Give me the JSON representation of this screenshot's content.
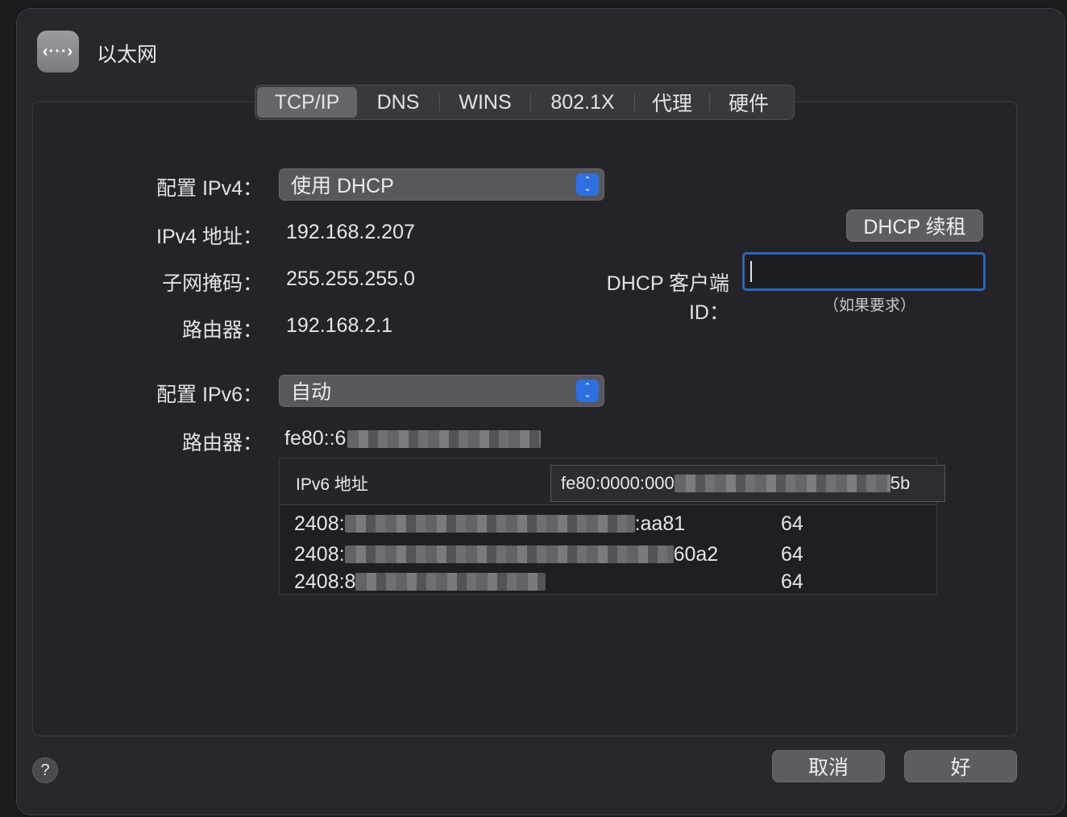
{
  "header": {
    "icon": "ethernet-dots-icon",
    "icon_glyph": "‹···›",
    "title": "以太网"
  },
  "tabs": [
    {
      "label": "TCP/IP",
      "active": true
    },
    {
      "label": "DNS"
    },
    {
      "label": "WINS"
    },
    {
      "label": "802.1X"
    },
    {
      "label": "代理"
    },
    {
      "label": "硬件"
    }
  ],
  "ipv4": {
    "configure_label": "配置 IPv4：",
    "configure_value": "使用 DHCP",
    "address_label": "IPv4 地址：",
    "address_value": "192.168.2.207",
    "subnet_label": "子网掩码：",
    "subnet_value": "255.255.255.0",
    "router_label": "路由器：",
    "router_value": "192.168.2.1"
  },
  "dhcp": {
    "renew_button": "DHCP 续租",
    "client_id_label": "DHCP 客户端 ID：",
    "client_id_value": "",
    "client_id_hint": "（如果要求）"
  },
  "ipv6": {
    "configure_label": "配置 IPv6：",
    "configure_value": "自动",
    "router_label": "路由器：",
    "router_value_visible": "fe80::6",
    "table_header": "IPv6 地址",
    "tooltip_start": "fe80:0000:000",
    "tooltip_end": "5b",
    "rows": [
      {
        "start": "2408:",
        "end": ":aa81",
        "prefix": "64"
      },
      {
        "start": "2408:",
        "end": "60a2",
        "prefix": "64"
      },
      {
        "start": "2408:8",
        "end": "",
        "prefix": "64"
      }
    ]
  },
  "footer": {
    "help": "?",
    "cancel": "取消",
    "ok": "好"
  },
  "colors": {
    "window_bg": "#29272d",
    "accent_blue": "#2f6fe0",
    "focus_ring": "#2d64b8"
  }
}
